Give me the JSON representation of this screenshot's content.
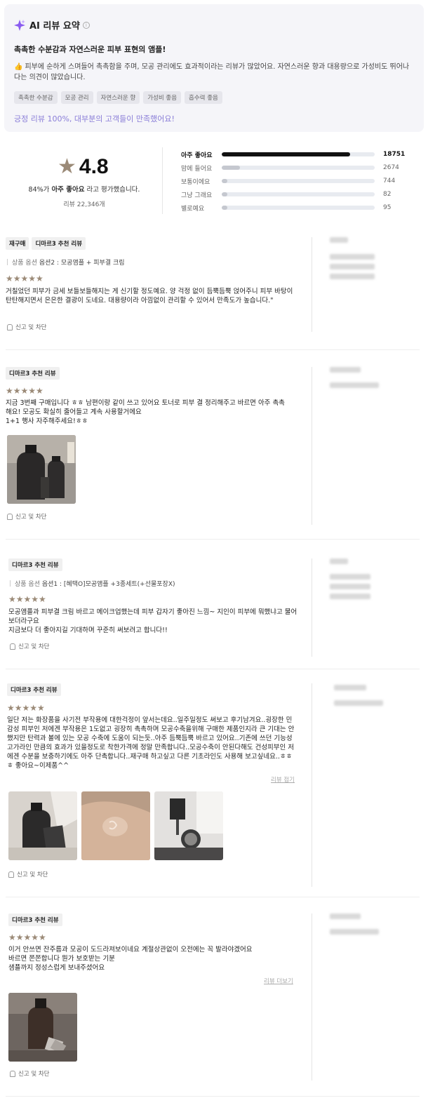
{
  "ai_summary": {
    "title": "AI 리뷰 요약",
    "headline": "촉촉한 수분감과 자연스러운 피부 표현의 앰플!",
    "body": "피부에 순하게 스며들어 촉촉함을 주며, 모공 관리에도 효과적이라는 리뷰가 많았어요. 자연스러운 향과 대용량으로 가성비도 뛰어나다는 의견이 많았습니다.",
    "tags": [
      "촉촉한 수분감",
      "모공 관리",
      "자연스러운 향",
      "가성비 좋음",
      "흡수력 좋음"
    ],
    "positive": "긍정 리뷰 100%, 대부분의 고객들이 만족했어요!",
    "accent_color": "#8a7ed8"
  },
  "rating": {
    "score": "4.8",
    "pct_prefix": "84%가",
    "pct_bold": "아주 좋아요",
    "pct_suffix": "라고 평가했습니다.",
    "count": "리뷰 22,346개",
    "star_color": "#9b8a77",
    "distribution": [
      {
        "label": "아주 좋아요",
        "count": "18751",
        "fraction": 0.84
      },
      {
        "label": "맘에 들어요",
        "count": "2674",
        "fraction": 0.12
      },
      {
        "label": "보통이에요",
        "count": "744",
        "fraction": 0.033
      },
      {
        "label": "그냥 그래요",
        "count": "82",
        "fraction": 0.004
      },
      {
        "label": "별로예요",
        "count": "95",
        "fraction": 0.004
      }
    ]
  },
  "reviews": [
    {
      "badges": [
        "재구매",
        "디마르3 추천 리뷰"
      ],
      "option_key": "상품 옵션",
      "option_value": "옵션2 : 모공앰플 + 피부결 크림",
      "stars": "★★★★★",
      "text": "거칠었던 피부가 금세 보들보들해지는 게 신기할 정도예요. 양 걱정 없이 듬뿍듬뿍 얹어주니 피부 바탕이 탄탄해지면서 은은한 결광이 도네요. 대용량이라 아낌없이 관리할 수 있어서 만족도가 높습니다.\"",
      "report": "신고 및 차단"
    },
    {
      "badges": [
        "디마르3 추천 리뷰"
      ],
      "stars": "★★★★★",
      "text_lines": [
        "지금 3번째 구매입니다 ㅎㅎ 남편이랑 같이 쓰고 있어요 토너로 피부 결 정리해주고 바르면 아주 촉촉해요! 모공도 확실히 줄어들고 계속 사용할거에요",
        "1+1 행사 자주해주세요!ㅎㅎ"
      ],
      "report": "신고 및 차단"
    },
    {
      "badges": [
        "디마르3 추천 리뷰"
      ],
      "option_key": "상품 옵션",
      "option_value": "옵션1 : [혜택O]모공앰플 +3종세트(+선물포장X)",
      "stars": "★★★★★",
      "text_lines": [
        "모공앰플과 피부결 크림 바르고 메이크업했는데 피부 갑자기 좋아진 느낌~ 지인이 피부에 뭐했냐고 물어보더라구요",
        "지금보다 더 좋아지길 기대하며 꾸준히 써보려고 합니다!!"
      ],
      "report": "신고 및 차단"
    },
    {
      "badges": [
        "디마르3 추천 리뷰"
      ],
      "stars": "★★★★★",
      "text": "일단 저는 화장품을 사기전 부작용에 대한걱정이 앞서는데요..일주일정도 써보고 후기남겨요..굉장한 민감성 피부인 저에겐 부작용은 1도없고 굉장히 촉촉하며 모공수축을위해 구매한 제품인지라 큰 기대는 안했지만 탄력과 볼에 있는 모공 수축에 도움이 되는듯..아주 듬뿍듬뿍 바르고 있어요..기존에 쓰던 기능성 고가라인 만큼의 효과가 있을정도로 착한가격에 정말 만족합니다..모공수축이 안된다해도 건성피부인 저에겐 수분을 보충하기에도 아주 단촉합니다..재구매 하고싶고 다른 기초라인도 사용해 보고싶네요..ㅎㅎㅎ 좋아요~이제품^^",
      "more": "리뷰 접기",
      "report": "신고 및 차단"
    },
    {
      "badges": [
        "디마르3 추천 리뷰"
      ],
      "stars": "★★★★★",
      "text_lines": [
        "이거 안쓰면 잔주름과 모공이 도드라져보이네요 계절상관없이 오전에는 꼭 발라야겠어요",
        "바르면 쫀쫀합니다 뭔가 보호받는 기분",
        "샘플까지 정성스럽게 보내주셨어요"
      ],
      "more": "리뷰 더보기",
      "report": "신고 및 차단"
    }
  ]
}
